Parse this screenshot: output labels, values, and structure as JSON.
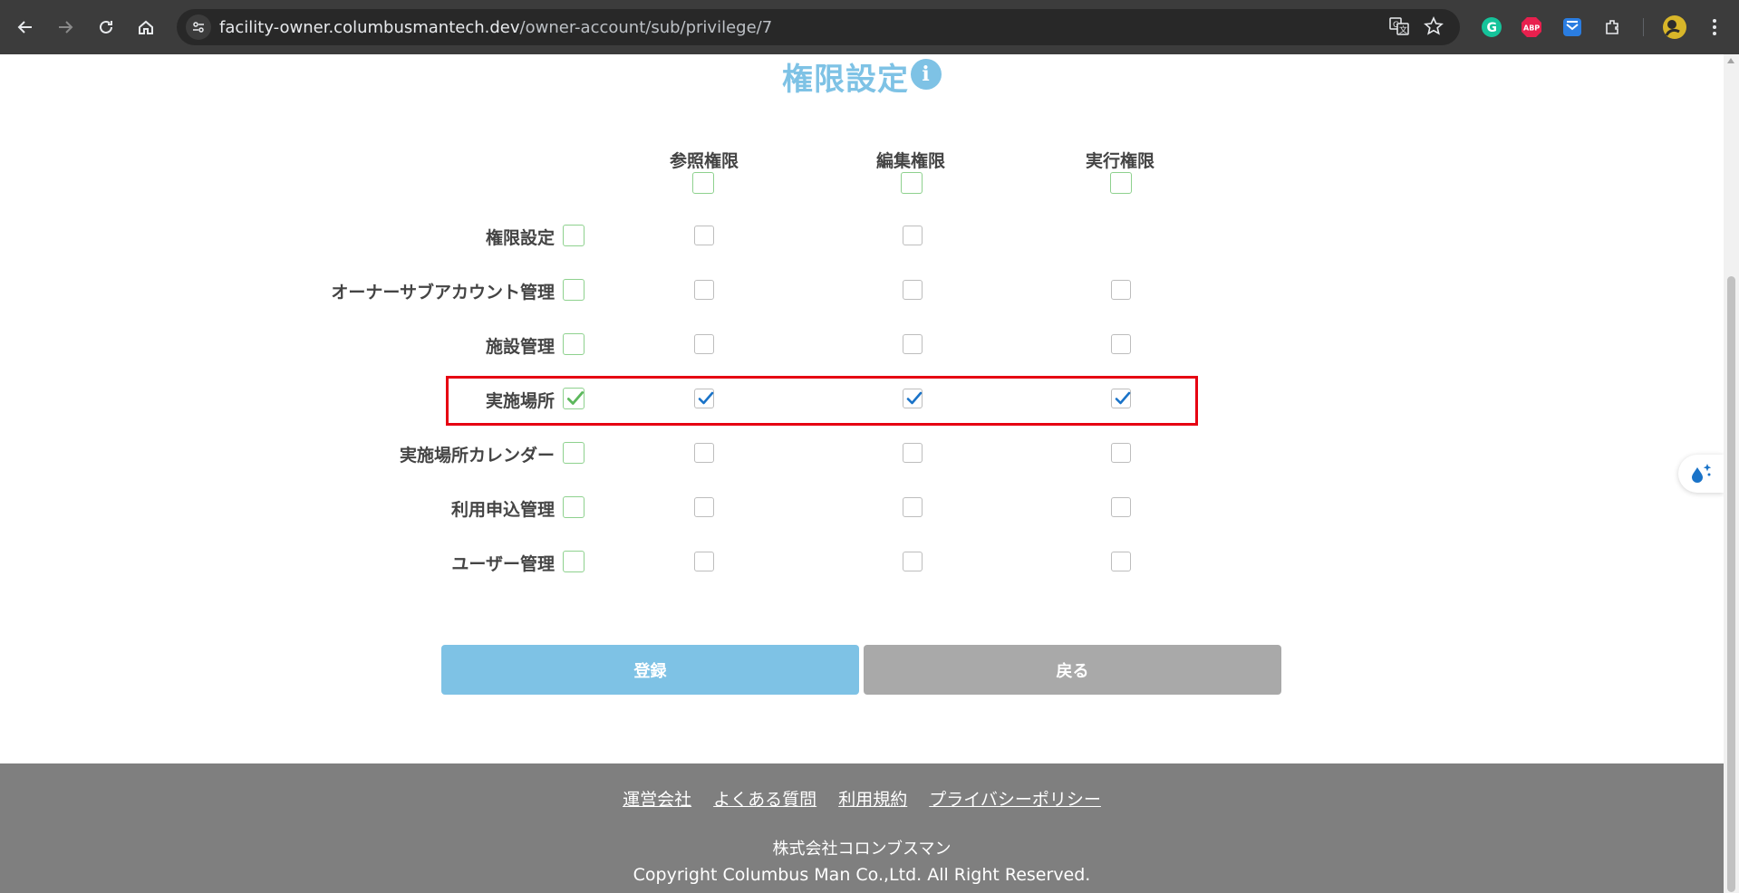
{
  "browser": {
    "url_host": "facility-owner.columbusmantech.dev",
    "url_path": "/owner-account/sub/privilege/7",
    "icons": [
      "back-icon",
      "forward-icon",
      "reload-icon",
      "home-icon",
      "site-info-icon",
      "translate-icon",
      "star-icon",
      "grammarly-icon",
      "adblock-icon",
      "pocket-icon",
      "extensions-icon",
      "profile-avatar",
      "menu-icon"
    ],
    "ext_labels": {
      "adblock": "ABP",
      "grammarly": "G"
    }
  },
  "page": {
    "title": "権限設定",
    "info_glyph": "i",
    "columns": [
      "参照権限",
      "編集権限",
      "実行権限"
    ],
    "rows": [
      {
        "label": "権限設定",
        "all": false,
        "view": false,
        "edit": false,
        "exec": null
      },
      {
        "label": "オーナーサブアカウント管理",
        "all": false,
        "view": false,
        "edit": false,
        "exec": false
      },
      {
        "label": "施設管理",
        "all": false,
        "view": false,
        "edit": false,
        "exec": false
      },
      {
        "label": "実施場所",
        "all": true,
        "view": true,
        "edit": true,
        "exec": true
      },
      {
        "label": "実施場所カレンダー",
        "all": false,
        "view": false,
        "edit": false,
        "exec": false
      },
      {
        "label": "利用申込管理",
        "all": false,
        "view": false,
        "edit": false,
        "exec": false
      },
      {
        "label": "ユーザー管理",
        "all": false,
        "view": false,
        "edit": false,
        "exec": false
      }
    ],
    "buttons": {
      "register": "登録",
      "back": "戻る"
    }
  },
  "footer": {
    "links": [
      "運営会社",
      "よくある質問",
      "利用規約",
      "プライバシーポリシー"
    ],
    "company": "株式会社コロンブスマン",
    "copyright": "Copyright Columbus Man Co.,Ltd. All Right Reserved."
  },
  "colors": {
    "accent": "#7ec2e5",
    "highlight": "#e60012",
    "check_blue": "#1a73c8",
    "check_green": "#5cb85c",
    "footer_bg": "#7f7f7f"
  }
}
